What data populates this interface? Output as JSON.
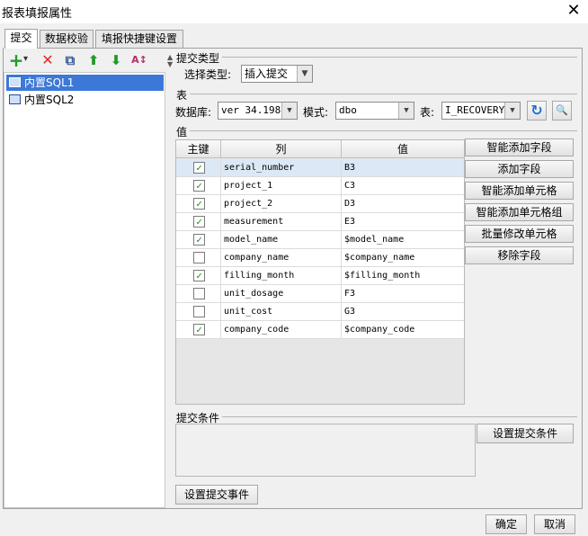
{
  "window": {
    "title": "报表填报属性",
    "close_symbol": "✕"
  },
  "tabs": [
    {
      "label": "提交",
      "active": true
    },
    {
      "label": "数据校验",
      "active": false
    },
    {
      "label": "填报快捷键设置",
      "active": false
    }
  ],
  "toolbar": {
    "add_symbol": "+",
    "add_dropdown": "▾",
    "delete_symbol": "✕",
    "copy_symbol": "⧉",
    "up_symbol": "⬆",
    "down_symbol": "⬇",
    "sort_symbol": "A↕"
  },
  "sql_list": [
    {
      "label": "内置SQL1",
      "selected": true
    },
    {
      "label": "内置SQL2",
      "selected": false
    }
  ],
  "submit_type": {
    "section": "提交类型",
    "label": "选择类型:",
    "value": "插入提交"
  },
  "table_section": {
    "section": "表",
    "database_label": "数据库:",
    "database_value": "ver 34.198",
    "schema_label": "模式:",
    "schema_value": "dbo",
    "table_label": "表:",
    "table_value": "I_RECOVERY",
    "refresh_symbol": "↻",
    "preview_symbol": "🔍"
  },
  "values_section": {
    "section": "值",
    "headers": {
      "key": "主键",
      "column": "列",
      "value": "值"
    },
    "rows": [
      {
        "key": true,
        "column": "serial_number",
        "value": "B3"
      },
      {
        "key": true,
        "column": "project_1",
        "value": "C3"
      },
      {
        "key": true,
        "column": "project_2",
        "value": "D3"
      },
      {
        "key": true,
        "column": "measurement",
        "value": "E3"
      },
      {
        "key": true,
        "column": "model_name",
        "value": "$model_name"
      },
      {
        "key": false,
        "column": "company_name",
        "value": "$company_name"
      },
      {
        "key": true,
        "column": "filling_month",
        "value": "$filling_month"
      },
      {
        "key": false,
        "column": "unit_dosage",
        "value": "F3"
      },
      {
        "key": false,
        "column": "unit_cost",
        "value": "G3"
      },
      {
        "key": true,
        "column": "company_code",
        "value": "$company_code"
      }
    ],
    "buttons": [
      "智能添加字段",
      "添加字段",
      "智能添加单元格",
      "智能添加单元格组",
      "批量修改单元格",
      "移除字段"
    ]
  },
  "condition": {
    "section": "提交条件",
    "button": "设置提交条件"
  },
  "event_button": "设置提交事件",
  "footer": {
    "ok": "确定",
    "cancel": "取消"
  },
  "colors": {
    "accent": "#3c78d8",
    "check": "#1a8a1a"
  }
}
